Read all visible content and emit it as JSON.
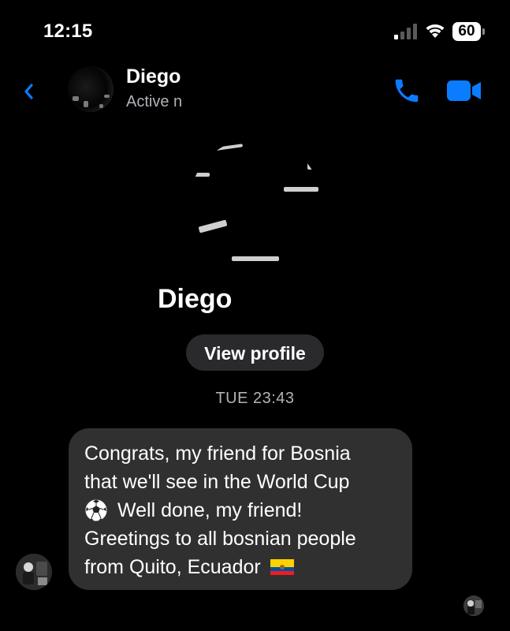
{
  "status_bar": {
    "time": "12:15",
    "battery_level": "60",
    "signal_icon": "cellular-signal-icon",
    "wifi_icon": "wifi-icon"
  },
  "header": {
    "back_icon": "chevron-left-icon",
    "name": "Diego A",
    "status": "Active no",
    "call_icon": "phone-icon",
    "video_icon": "video-camera-icon"
  },
  "profile": {
    "name": "Diego",
    "view_profile_label": "View profile"
  },
  "conversation": {
    "timestamp": "TUE 23:43",
    "messages": [
      {
        "lines": [
          "Congrats, my friend for Bosnia",
          "that we'll see in the World Cup",
          "Well done, my friend!",
          "Greetings to all bosnian people",
          "from Quito, Ecuador"
        ],
        "emoji_icons": [
          "soccer-ball-icon",
          "flag-ecuador-icon"
        ]
      }
    ]
  },
  "colors": {
    "background": "#000000",
    "accent": "#0a7cff",
    "bubble": "#303030",
    "secondary_text": "#b0b3b8"
  }
}
